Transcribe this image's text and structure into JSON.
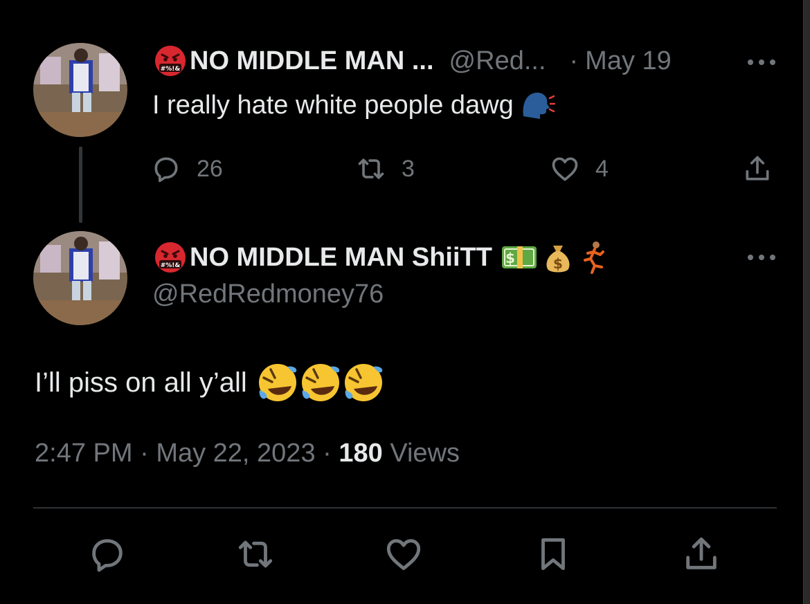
{
  "tweet1": {
    "display_name": "NO MIDDLE MAN ...",
    "handle": "@Red...",
    "separator": "·",
    "date": "May 19",
    "text": "I really hate white people  dawg",
    "reply_count": "26",
    "retweet_count": "3",
    "like_count": "4"
  },
  "tweet2": {
    "display_name": "NO MIDDLE MAN ShiiTT",
    "handle": "@RedRedmoney76",
    "text": "I’ll piss on all  y’all",
    "time": "2:47 PM",
    "separator": "·",
    "date": "May 22, 2023",
    "views_count": "180",
    "views_label": "Views"
  },
  "icons": {
    "angry": "face-with-symbols-on-mouth-icon",
    "speaking": "speaking-head-icon",
    "money": "dollar-banknote-icon",
    "bag": "money-bag-icon",
    "runner": "person-running-icon",
    "rofl": "rolling-on-floor-laughing-icon"
  },
  "colors": {
    "background": "#000000",
    "text": "#e7e9ea",
    "secondary": "#71767b",
    "divider": "#2f3336"
  }
}
